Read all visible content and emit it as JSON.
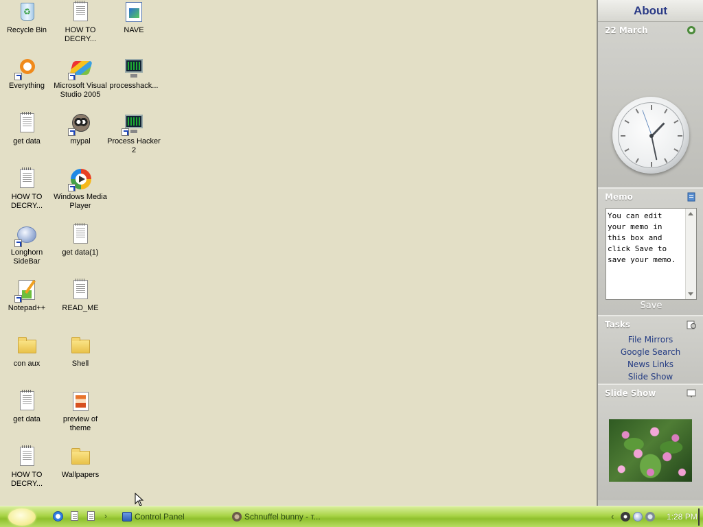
{
  "desktop": {
    "icons": [
      {
        "label": "Recycle Bin",
        "icon": "recycle-bin-icon",
        "shortcut": false
      },
      {
        "label": "HOW TO\nDECRY...",
        "icon": "text-file-icon",
        "shortcut": false
      },
      {
        "label": "NAVE",
        "icon": "image-file-icon",
        "shortcut": false
      },
      {
        "label": "Everything",
        "icon": "everything-search-icon",
        "shortcut": true
      },
      {
        "label": "Microsoft Visual\nStudio 2005",
        "icon": "visual-studio-icon",
        "shortcut": true
      },
      {
        "label": "processhack...",
        "icon": "process-hacker-icon",
        "shortcut": false
      },
      {
        "label": "get data",
        "icon": "text-file-icon",
        "shortcut": false
      },
      {
        "label": "mypal",
        "icon": "mypal-browser-icon",
        "shortcut": true
      },
      {
        "label": "Process Hacker\n2",
        "icon": "process-hacker-icon",
        "shortcut": true
      },
      {
        "label": "HOW TO\nDECRY...",
        "icon": "text-file-icon",
        "shortcut": false
      },
      {
        "label": "Windows Media\nPlayer",
        "icon": "windows-media-player-icon",
        "shortcut": true
      },
      {
        "label": "Longhorn\nSideBar",
        "icon": "longhorn-sidebar-icon",
        "shortcut": true
      },
      {
        "label": "get data(1)",
        "icon": "text-file-icon",
        "shortcut": false
      },
      {
        "label": "Notepad++",
        "icon": "notepad-plus-plus-icon",
        "shortcut": true
      },
      {
        "label": "READ_ME",
        "icon": "text-file-icon",
        "shortcut": false
      },
      {
        "label": "con aux",
        "icon": "folder-icon",
        "shortcut": false
      },
      {
        "label": "Shell",
        "icon": "folder-icon",
        "shortcut": false
      },
      {
        "label": "get data",
        "icon": "text-file-icon",
        "shortcut": false
      },
      {
        "label": "preview of\ntheme",
        "icon": "theme-file-icon",
        "shortcut": false
      },
      {
        "label": "HOW TO\nDECRY...",
        "icon": "text-file-icon",
        "shortcut": false
      },
      {
        "label": "Wallpapers",
        "icon": "folder-icon",
        "shortcut": false
      }
    ]
  },
  "sidebar": {
    "title": "About",
    "clock": {
      "date": "22 March",
      "time": "1:28"
    },
    "memo": {
      "title": "Memo",
      "text": "You can edit your memo in this box and click Save to save your memo.",
      "save_label": "Save"
    },
    "tasks": {
      "title": "Tasks",
      "links": [
        "File Mirrors",
        "Google Search",
        "News Links",
        "Slide Show"
      ]
    },
    "slideshow": {
      "title": "Slide Show",
      "image": "water-lilies-photo"
    }
  },
  "taskbar": {
    "start_icon": "start-orb-icon",
    "quick_launch": [
      "internet-explorer-icon",
      "text-file-icon",
      "text-file-icon"
    ],
    "quick_launch_more": "›",
    "tasks": [
      {
        "label": "Control Panel",
        "icon": "control-panel-icon"
      },
      {
        "label": "Schnuffel bunny - т...",
        "icon": "schnuffel-bunny-icon"
      }
    ],
    "tray": {
      "chevron": "‹",
      "time": "1:28 PM"
    }
  },
  "colors": {
    "desktop_background": "#e3dfc6",
    "sidebar_title": "#2a3a86",
    "task_link": "#223a82",
    "taskbar_green": "#a9d447"
  }
}
